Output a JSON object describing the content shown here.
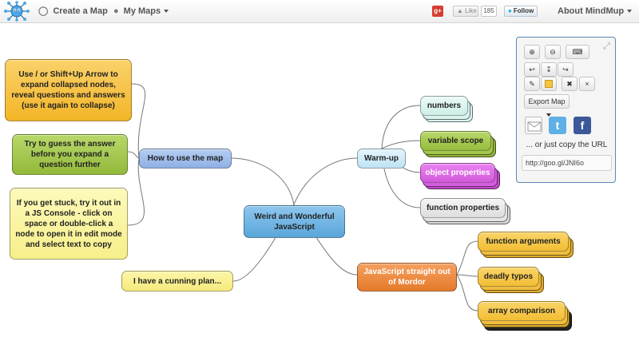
{
  "topbar": {
    "logo_icon": "mindmup-logo-icon",
    "create_map": "Create a Map",
    "create_map_icon": "lightbulb-icon",
    "my_maps": "My Maps",
    "my_maps_icon": "user-icon",
    "gplus_label": "g+",
    "like_label": "Like",
    "like_count": "185",
    "follow_label": "Follow",
    "about": "About MindMup"
  },
  "map": {
    "root": "Weird and Wonderful JavaScript",
    "how_to": "How to use the map",
    "tip_expand": "Use / or Shift+Up Arrow to expand collapsed nodes, reveal questions and answers (use it again to collapse)",
    "tip_guess": "Try to guess the answer before you expand a question further",
    "tip_console": "If you get stuck, try it out in a JS Console - click on space or double-click a node to open it in edit mode and select text to copy",
    "cunning_plan": "I have a cunning plan...",
    "warmup": "Warm-up",
    "numbers": "numbers",
    "variable_scope": "variable scope",
    "object_properties": "object properties",
    "function_properties": "function properties",
    "mordor": "JavaScript straight out of Mordor",
    "function_arguments": "function arguments",
    "deadly_typos": "deadly typos",
    "array_comparison": "array comparison",
    "colors": {
      "yellow": "#f9e79a",
      "orange": "#f6b93b",
      "green": "#a3c64b",
      "blue": "#8fb6ea",
      "cyan": "#6ab4e0",
      "mint": "#d9f3ef",
      "magenta": "#d65ee0",
      "grey": "#e4e4e4",
      "burnt": "#ec8a3a",
      "gold": "#f5c542"
    }
  },
  "panel": {
    "zoom_in_icon": "zoom-in-icon",
    "zoom_out_icon": "zoom-out-icon",
    "keyboard_icon": "keyboard-icon",
    "export_map": "Export Map",
    "copy_url_text": "... or just copy the URL",
    "url": "http://goo.gl/JNI6o",
    "twitter_label": "t",
    "facebook_label": "f"
  }
}
